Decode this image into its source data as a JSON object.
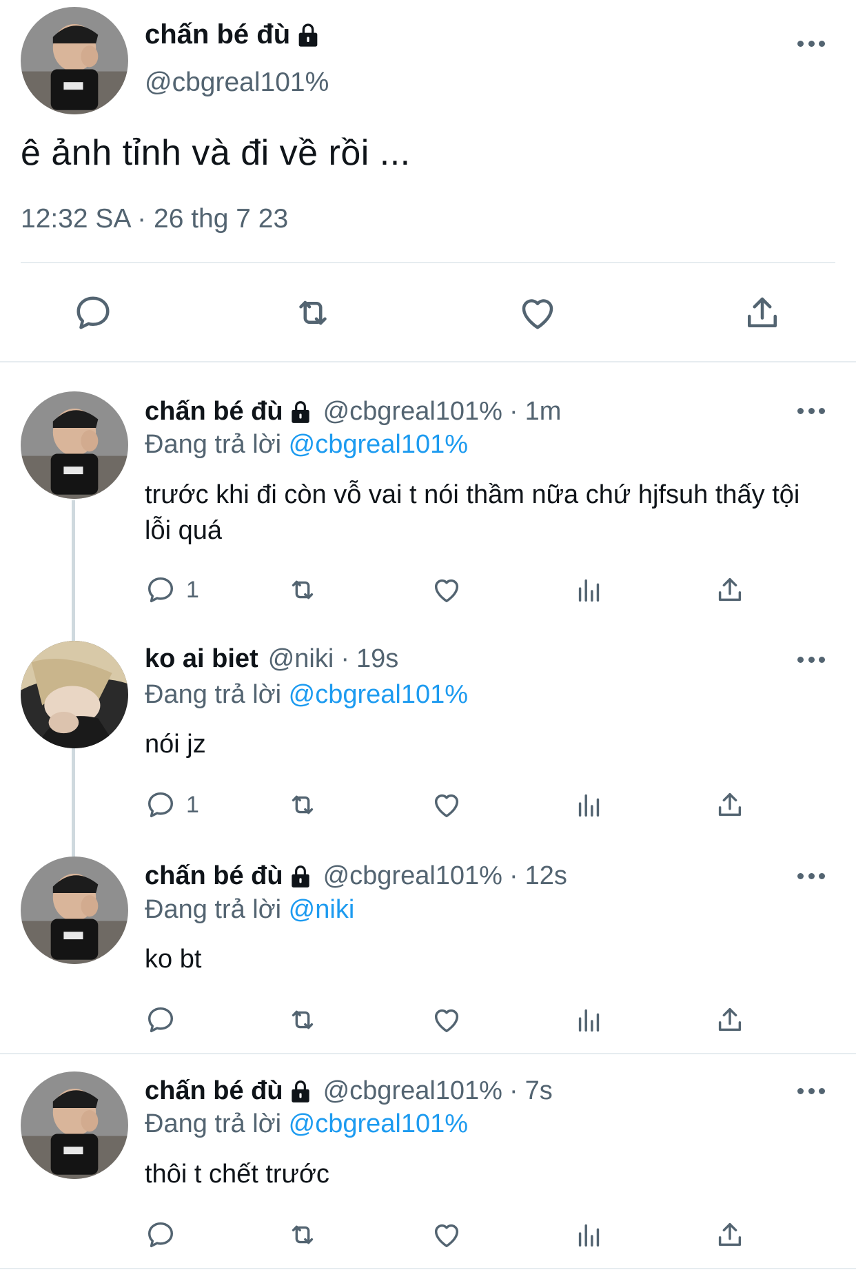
{
  "main_tweet": {
    "display_name": "chấn bé đù",
    "handle": "@cbgreal101%",
    "text": "ê ảnh tỉnh và đi về rồi ...",
    "time": "12:32 SA",
    "separator": "·",
    "date": "26 thg 7 23"
  },
  "actions_icons": [
    "reply-icon",
    "retweet-icon",
    "like-icon",
    "share-icon",
    "views-icon"
  ],
  "replies": [
    {
      "display_name": "chấn bé đù",
      "handle": "@cbgreal101%",
      "separator": "·",
      "time": "1m",
      "replying_prefix": "Đang trả lời",
      "replying_to": "@cbgreal101%",
      "text": "trước khi đi còn vỗ vai t nói thầm nữa chứ hjfsuh thấy tội lỗi quá",
      "reply_count": "1"
    },
    {
      "display_name": "ko ai biet",
      "handle": "@niki",
      "separator": "·",
      "time": "19s",
      "replying_prefix": "Đang trả lời",
      "replying_to": "@cbgreal101%",
      "text": "nói jz",
      "reply_count": "1"
    },
    {
      "display_name": "chấn bé đù",
      "handle": "@cbgreal101%",
      "separator": "·",
      "time": "12s",
      "replying_prefix": "Đang trả lời",
      "replying_to": "@niki",
      "text": "ko bt",
      "reply_count": ""
    },
    {
      "display_name": "chấn bé đù",
      "handle": "@cbgreal101%",
      "separator": "·",
      "time": "7s",
      "replying_prefix": "Đang trả lời",
      "replying_to": "@cbgreal101%",
      "text": "thôi t chết trước",
      "reply_count": ""
    }
  ],
  "colors": {
    "link": "#1d9bf0",
    "secondary_text": "#536471",
    "primary_text": "#0f1419",
    "divider": "#e6ecf0"
  }
}
